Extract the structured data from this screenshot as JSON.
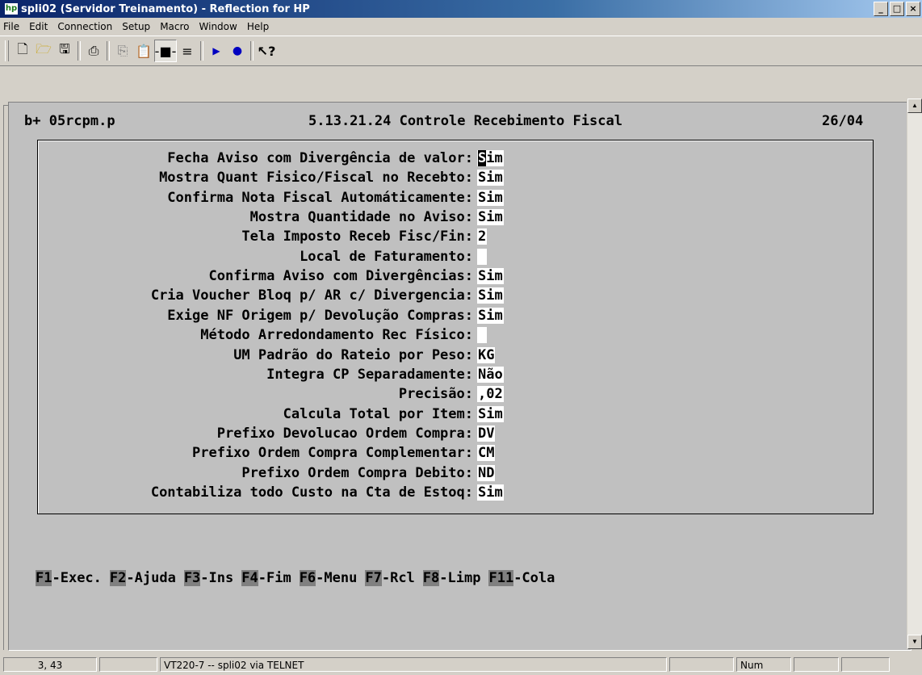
{
  "window": {
    "title": "spli02 (Servidor Treinamento) - Reflection for HP",
    "app_icon_text": "hp",
    "buttons": [
      "_",
      "□",
      "×"
    ]
  },
  "menu": [
    "File",
    "Edit",
    "Connection",
    "Setup",
    "Macro",
    "Window",
    "Help"
  ],
  "toolbar": {
    "icons": [
      "new-icon",
      "open-icon",
      "save-icon",
      "print-icon",
      "copy-icon",
      "paste-icon",
      "connect-icon",
      "macro-icon",
      "play-icon",
      "record-icon",
      "help-icon"
    ]
  },
  "terminal": {
    "header": {
      "program": "b+ 05rcpm.p",
      "title": "5.13.21.24 Controle Recebimento Fiscal",
      "date": "26/04"
    },
    "fields": [
      {
        "label": "Fecha Aviso com Divergência de valor:",
        "value": "Sim",
        "cursor": true
      },
      {
        "label": "Mostra Quant Fisico/Fiscal no Recebto:",
        "value": "Sim"
      },
      {
        "label": "Confirma Nota Fiscal Automáticamente:",
        "value": "Sim"
      },
      {
        "label": "Mostra Quantidade no Aviso:",
        "value": "Sim"
      },
      {
        "label": "Tela Imposto Receb Fisc/Fin:",
        "value": "2"
      },
      {
        "label": "Local de Faturamento:",
        "value": ""
      },
      {
        "label": "Confirma Aviso com Divergências:",
        "value": "Sim"
      },
      {
        "label": "Cria Voucher Bloq p/ AR c/ Divergencia:",
        "value": "Sim"
      },
      {
        "label": "Exige NF Origem p/ Devolução Compras:",
        "value": "Sim"
      },
      {
        "label": "Método Arredondamento Rec Físico:",
        "value": ""
      },
      {
        "label": "UM Padrão do Rateio por Peso:",
        "value": "KG"
      },
      {
        "label": "Integra CP Separadamente:",
        "value": "Não"
      },
      {
        "label": "Precisão:",
        "value": ",02"
      },
      {
        "label": "Calcula Total por Item:",
        "value": "Sim"
      },
      {
        "label": "Prefixo Devolucao Ordem Compra:",
        "value": "DV"
      },
      {
        "label": "Prefixo Ordem Compra Complementar:",
        "value": "CM"
      },
      {
        "label": "Prefixo Ordem Compra Debito:",
        "value": "ND"
      },
      {
        "label": "Contabiliza todo Custo na Cta de Estoq:",
        "value": "Sim"
      }
    ],
    "function_keys": [
      {
        "key": "F1",
        "label": "-Exec."
      },
      {
        "key": "F2",
        "label": "-Ajuda"
      },
      {
        "key": "F3",
        "label": "-Ins"
      },
      {
        "key": "F4",
        "label": "-Fim"
      },
      {
        "key": "F6",
        "label": "-Menu"
      },
      {
        "key": "F7",
        "label": "-Rcl"
      },
      {
        "key": "F8",
        "label": "-Limp"
      },
      {
        "key": "F11",
        "label": "-Cola"
      }
    ]
  },
  "status": {
    "cursor_pos": "3, 43",
    "connection": "VT220-7 -- spli02 via TELNET",
    "num": "Num"
  }
}
